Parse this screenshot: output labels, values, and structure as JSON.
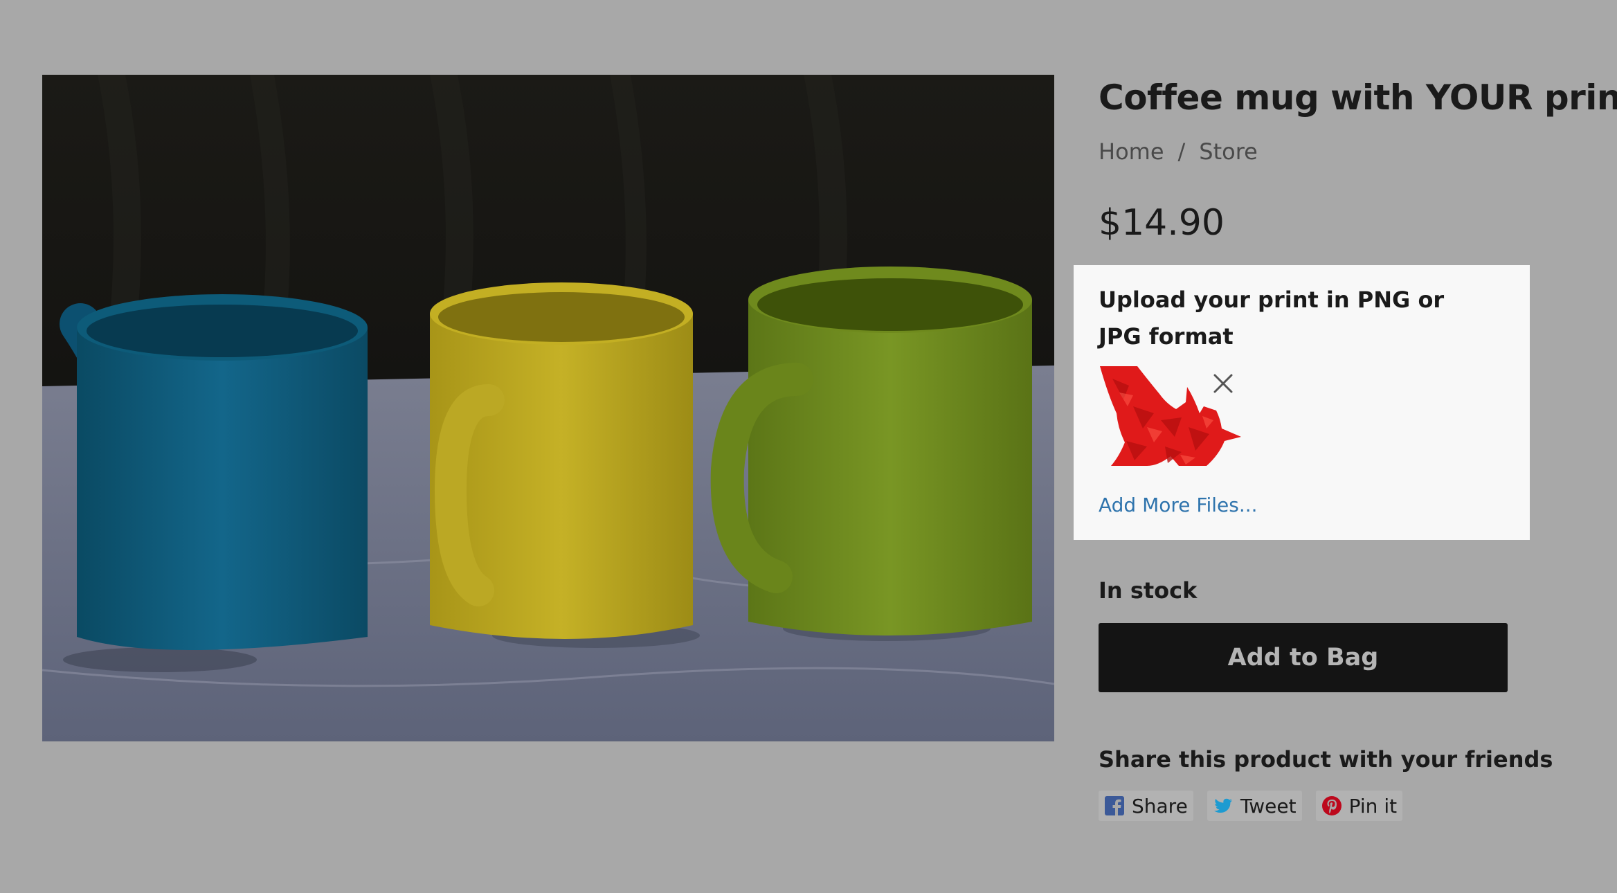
{
  "product": {
    "title": "Coffee mug with YOUR print",
    "breadcrumb": {
      "home": "Home",
      "separator": "/",
      "store": "Store"
    },
    "price": "$14.90",
    "image_alt": "three-mugs-photo"
  },
  "upload": {
    "label": "Upload your print in PNG or JPG format",
    "file_thumbnail": "red-bird-print",
    "remove_icon": "close-icon",
    "add_more": "Add More Files..."
  },
  "stock": {
    "status": "In stock"
  },
  "actions": {
    "add_to_bag": "Add to Bag"
  },
  "share": {
    "heading": "Share this product with your friends",
    "buttons": [
      {
        "label": "Share",
        "icon": "facebook-icon",
        "color": "#3b5998"
      },
      {
        "label": "Tweet",
        "icon": "twitter-icon",
        "color": "#1d9bd1"
      },
      {
        "label": "Pin it",
        "icon": "pinterest-icon",
        "color": "#bd081c"
      }
    ]
  },
  "colors": {
    "overlay": "#a8a8a8",
    "button_bg": "#141414",
    "link": "#2f74ad",
    "mug_blue": "#0e5874",
    "mug_yellow": "#b9a720",
    "mug_green": "#6e8a1c"
  }
}
